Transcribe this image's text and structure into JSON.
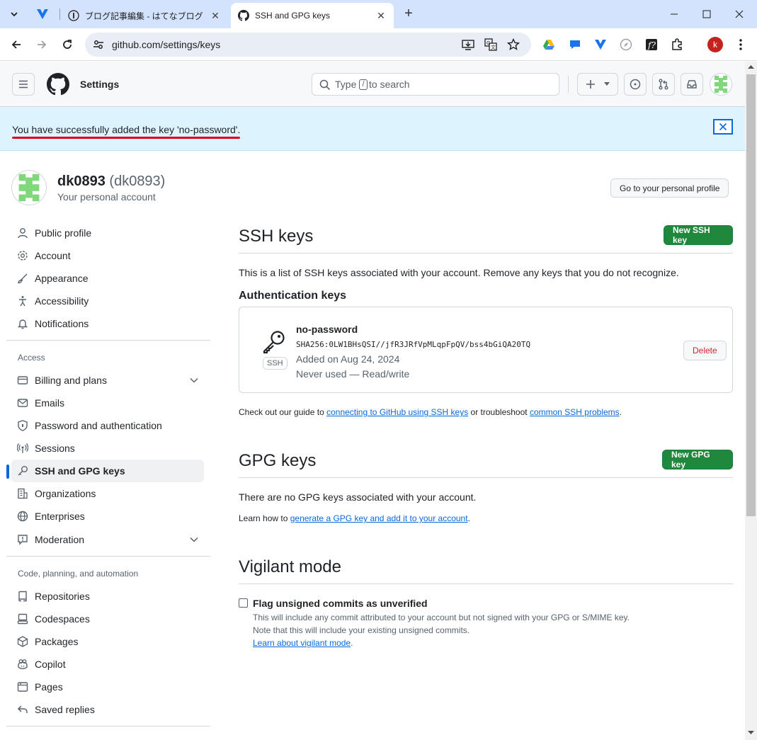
{
  "browser": {
    "tabs": [
      {
        "title": "ブログ記事編集 - はてなブログ",
        "active": false
      },
      {
        "title": "SSH and GPG keys",
        "active": true
      }
    ],
    "url": "github.com/settings/keys",
    "profile_initial": "k"
  },
  "header": {
    "title": "Settings",
    "search_prefix": "Type",
    "search_key": "/",
    "search_suffix": "to search"
  },
  "flash": {
    "message": "You have successfully added the key 'no-password'."
  },
  "account": {
    "name": "dk0893",
    "handle": "(dk0893)",
    "subtitle": "Your personal account",
    "profile_button": "Go to your personal profile"
  },
  "sidebar": {
    "group1": [
      "Public profile",
      "Account",
      "Appearance",
      "Accessibility",
      "Notifications"
    ],
    "access_heading": "Access",
    "access": [
      "Billing and plans",
      "Emails",
      "Password and authentication",
      "Sessions",
      "SSH and GPG keys",
      "Organizations",
      "Enterprises",
      "Moderation"
    ],
    "code_heading": "Code, planning, and automation",
    "code": [
      "Repositories",
      "Codespaces",
      "Packages",
      "Copilot",
      "Pages",
      "Saved replies"
    ]
  },
  "ssh": {
    "title": "SSH keys",
    "new_button": "New SSH key",
    "description": "This is a list of SSH keys associated with your account. Remove any keys that you do not recognize.",
    "auth_heading": "Authentication keys",
    "key": {
      "name": "no-password",
      "fingerprint": "SHA256:0LW1BHsQSI//jfR3JRfVpMLqpFpQV/bss4bGiQA20TQ",
      "added": "Added on Aug 24, 2024",
      "usage": "Never used — Read/write",
      "badge": "SSH",
      "delete": "Delete"
    },
    "guide_prefix": "Check out our guide to",
    "guide_link1": "connecting to GitHub using SSH keys",
    "guide_mid": "or troubleshoot",
    "guide_link2": "common SSH problems",
    "guide_end": "."
  },
  "gpg": {
    "title": "GPG keys",
    "new_button": "New GPG key",
    "empty": "There are no GPG keys associated with your account.",
    "learn_prefix": "Learn how to",
    "learn_link": "generate a GPG key and add it to your account",
    "learn_end": "."
  },
  "vigilant": {
    "title": "Vigilant mode",
    "checkbox_label": "Flag unsigned commits as unverified",
    "desc1": "This will include any commit attributed to your account but not signed with your GPG or S/MIME key.",
    "desc2": "Note that this will include your existing unsigned commits.",
    "link": "Learn about vigilant mode",
    "link_end": "."
  },
  "colors": {
    "accent": "#0969da",
    "green": "#1f883d",
    "danger": "#d1242f",
    "flash_bg": "#ddf4ff"
  }
}
